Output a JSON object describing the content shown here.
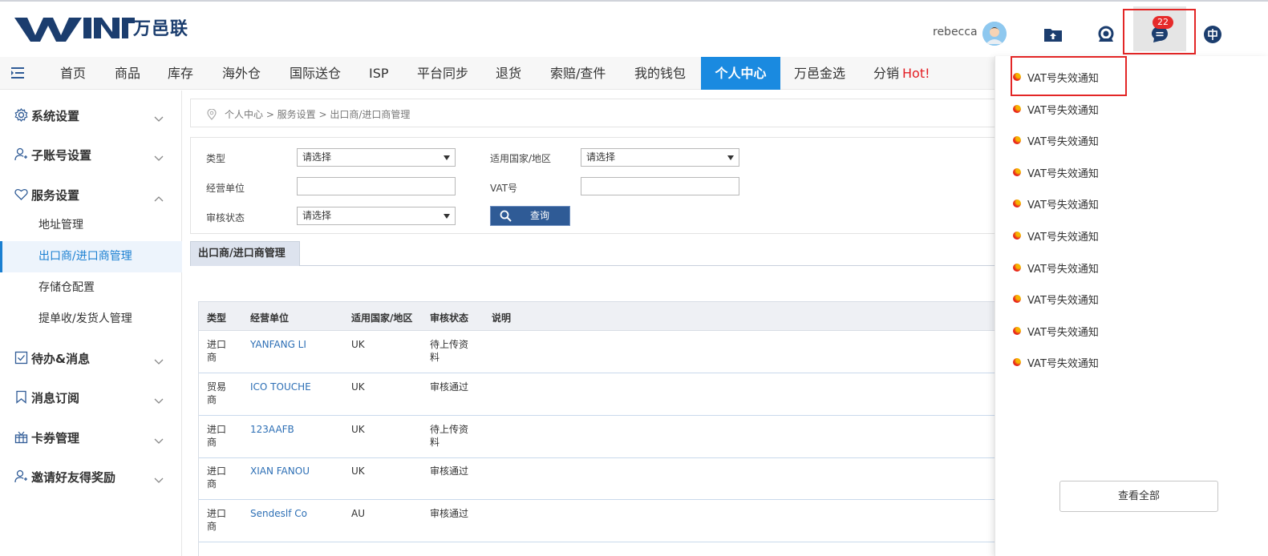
{
  "header": {
    "logo_text": "万邑联",
    "username": "rebecca",
    "badge_count": "22"
  },
  "nav": {
    "items": [
      {
        "label": "首页"
      },
      {
        "label": "商品"
      },
      {
        "label": "库存"
      },
      {
        "label": "海外仓"
      },
      {
        "label": "国际送仓"
      },
      {
        "label": "ISP"
      },
      {
        "label": "平台同步"
      },
      {
        "label": "退货"
      },
      {
        "label": "索赔/查件"
      },
      {
        "label": "我的钱包"
      },
      {
        "label": "个人中心"
      },
      {
        "label": "万邑金选"
      },
      {
        "label": "分销"
      }
    ],
    "hot_label": "Hot!",
    "active_color": "#1a8ae0"
  },
  "sidebar": {
    "groups": [
      {
        "label": "系统设置",
        "icon": "gear-icon"
      },
      {
        "label": "子账号设置",
        "icon": "user-add-icon"
      },
      {
        "label": "服务设置",
        "icon": "heart-icon"
      },
      {
        "label": "待办&消息",
        "icon": "checkbox-icon"
      },
      {
        "label": "消息订阅",
        "icon": "bookmark-icon"
      },
      {
        "label": "卡券管理",
        "icon": "gift-icon"
      },
      {
        "label": "邀请好友得奖励",
        "icon": "user-add-icon"
      }
    ],
    "sub_items": [
      {
        "label": "地址管理"
      },
      {
        "label": "出口商/进口商管理"
      },
      {
        "label": "存储仓配置"
      },
      {
        "label": "提单收/发货人管理"
      }
    ]
  },
  "breadcrumb": "个人中心 > 服务设置 > 出口商/进口商管理",
  "filters": {
    "type_label": "类型",
    "type_value": "请选择",
    "country_label": "适用国家/地区",
    "country_value": "请选择",
    "unit_label": "经营单位",
    "vat_label": "VAT号",
    "status_label": "审核状态",
    "status_value": "请选择",
    "query_label": "查询"
  },
  "tab_label": "出口商/进口商管理",
  "table": {
    "headers": [
      "类型",
      "经营单位",
      "适用国家/地区",
      "审核状态",
      "说明"
    ],
    "rows": [
      {
        "type": "进口商",
        "unit": "YANFANG LI",
        "country": "UK",
        "status": "待上传资料"
      },
      {
        "type": "贸易商",
        "unit": "ICO TOUCHE",
        "country": "UK",
        "status": "审核通过"
      },
      {
        "type": "进口商",
        "unit": "123AAFB",
        "country": "UK",
        "status": "待上传资料"
      },
      {
        "type": "进口商",
        "unit": "XIAN FANOU",
        "country": "UK",
        "status": "审核通过"
      },
      {
        "type": "进口商",
        "unit": "Sendeslf Co",
        "country": "AU",
        "status": "审核通过"
      }
    ]
  },
  "notifications": {
    "items": [
      "VAT号失效通知",
      "VAT号失效通知",
      "VAT号失效通知",
      "VAT号失效通知",
      "VAT号失效通知",
      "VAT号失效通知",
      "VAT号失效通知",
      "VAT号失效通知",
      "VAT号失效通知",
      "VAT号失效通知"
    ],
    "view_all": "查看全部"
  }
}
